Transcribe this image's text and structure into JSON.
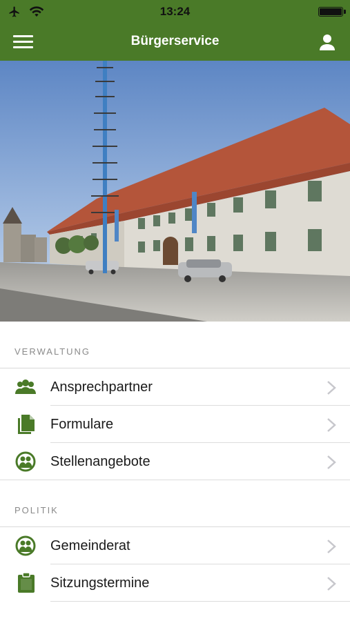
{
  "status_bar": {
    "time": "13:24"
  },
  "nav": {
    "title": "Bürgerservice"
  },
  "sections": [
    {
      "header": "VERWALTUNG",
      "items": [
        {
          "label": "Ansprechpartner",
          "icon": "contacts-icon"
        },
        {
          "label": "Formulare",
          "icon": "documents-icon"
        },
        {
          "label": "Stellenangebote",
          "icon": "people-circle-icon"
        }
      ]
    },
    {
      "header": "POLITIK",
      "items": [
        {
          "label": "Gemeinderat",
          "icon": "people-circle-icon"
        },
        {
          "label": "Sitzungstermine",
          "icon": "clipboard-icon"
        }
      ]
    }
  ],
  "colors": {
    "brand_green": "#4a7a28",
    "icon_green": "#4a7a28",
    "chevron": "#c7c7cc"
  }
}
